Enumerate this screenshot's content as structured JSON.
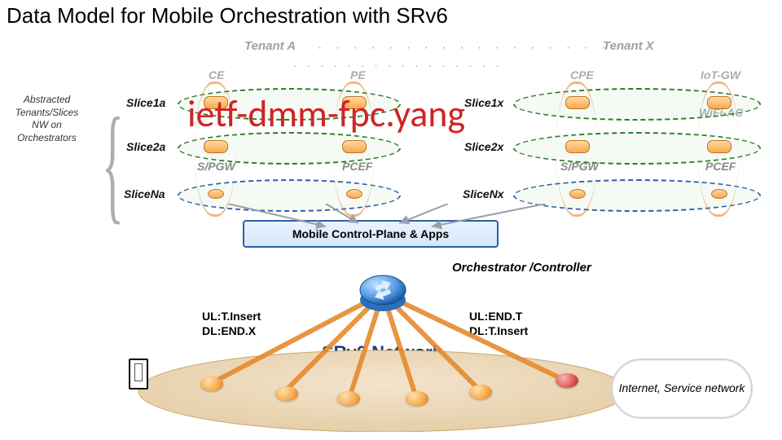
{
  "title": "Data Model for Mobile Orchestration with SRv6",
  "tenants": {
    "a": "Tenant A",
    "x": "Tenant X"
  },
  "columns": {
    "ce": "CE",
    "pe": "PE",
    "cpe": "CPE",
    "iot": "IoT-GW",
    "wifi": "WiFi-AC"
  },
  "slices": {
    "s1a": "Slice1a",
    "s2a": "Slice2a",
    "sNa": "SliceNa",
    "s1x": "Slice1x",
    "s2x": "Slice2x",
    "sNx": "SliceNx"
  },
  "spgw": "S/PGW",
  "pcef": "PCEF",
  "ietf": "ietf-dmm-fpc.yang",
  "side": "Abstracted Tenants/Slices NW on Orchestrators",
  "mcp": "Mobile Control-Plane & Apps",
  "orch": "Orchestrator /Controller",
  "ul1": "UL:T.Insert",
  "dl1": "DL:END.X",
  "ul2": "UL:END.T",
  "dl2": "DL:T.Insert",
  "srv6": "SRv6 Network",
  "cloud": "Internet, Service network"
}
